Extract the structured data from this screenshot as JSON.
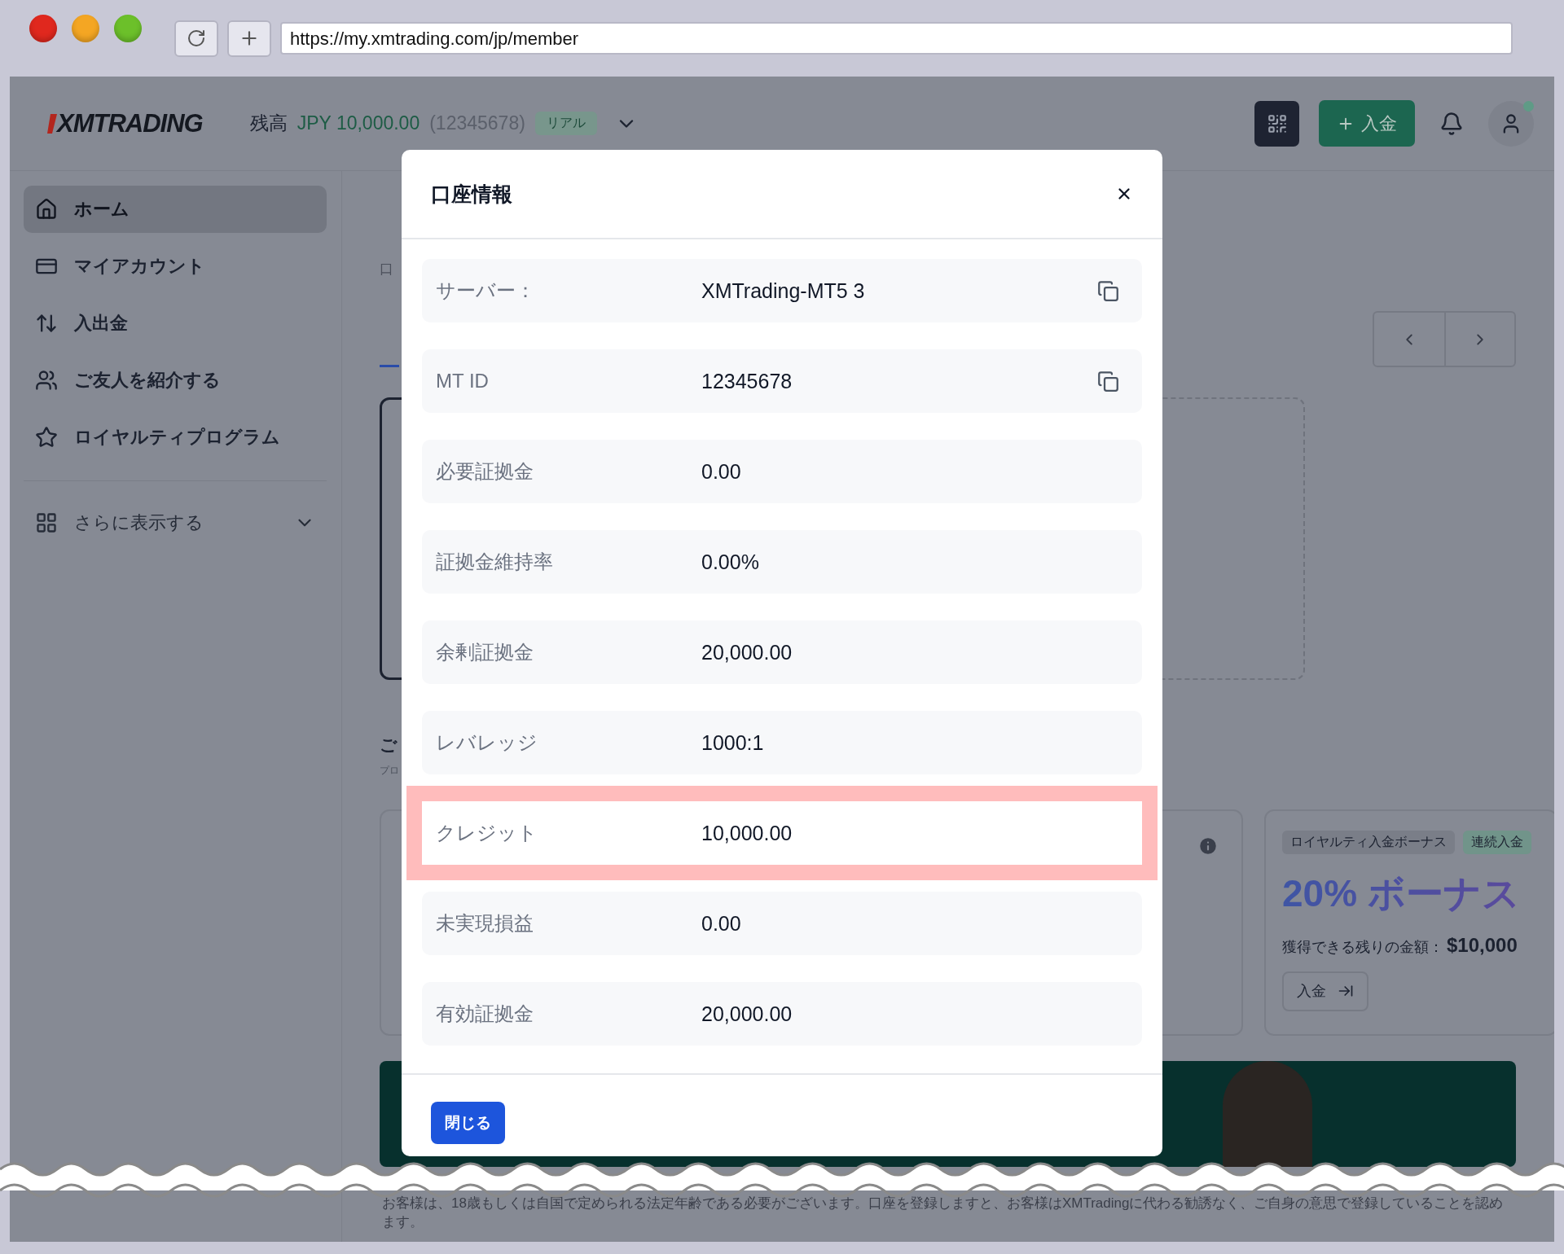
{
  "browser": {
    "url": "https://my.xmtrading.com/jp/member"
  },
  "header": {
    "logo": "XMTRADING",
    "balance_label": "残高",
    "balance": "JPY 10,000.00",
    "account_number": "(12345678)",
    "account_type": "リアル",
    "deposit_button": "入金"
  },
  "sidebar": {
    "items": [
      {
        "label": "ホーム",
        "kind": "home",
        "selected": true
      },
      {
        "label": "マイアカウント",
        "kind": "card",
        "selected": false
      },
      {
        "label": "入出金",
        "kind": "transfer",
        "selected": false
      },
      {
        "label": "ご友人を紹介する",
        "kind": "people",
        "selected": false
      },
      {
        "label": "ロイヤルティプログラム",
        "kind": "star",
        "selected": false
      }
    ],
    "more": {
      "label": "さらに表示する",
      "expanded": false
    }
  },
  "background": {
    "section_1_subtitle": "口",
    "section_2_title": "ご",
    "section_2_subtitle": "プロ"
  },
  "promo_card": {
    "tags": [
      {
        "label": "ロイヤルティ入金ボーナス",
        "color": "#7a7e88"
      },
      {
        "label": "連続入金",
        "color": "#71948a"
      }
    ],
    "title": "20% ボーナス",
    "remaining_label": "獲得できる残りの金額：",
    "remaining_amount": "$10,000",
    "button": "入金"
  },
  "modal": {
    "title": "口座情報",
    "rows": [
      {
        "label": "サーバー：",
        "value": "XMTrading-MT5 3",
        "copyable": true,
        "highlighted": false
      },
      {
        "label": "MT ID",
        "value": "12345678",
        "copyable": true,
        "highlighted": false
      },
      {
        "label": "必要証拠金",
        "value": "0.00",
        "copyable": false,
        "highlighted": false
      },
      {
        "label": "証拠金維持率",
        "value": "0.00%",
        "copyable": false,
        "highlighted": false
      },
      {
        "label": "余剰証拠金",
        "value": "20,000.00",
        "copyable": false,
        "highlighted": false
      },
      {
        "label": "レバレッジ",
        "value": "1000:1",
        "copyable": false,
        "highlighted": false
      },
      {
        "label": "クレジット",
        "value": "10,000.00",
        "copyable": false,
        "highlighted": true
      },
      {
        "label": "未実現損益",
        "value": "0.00",
        "copyable": false,
        "highlighted": false
      },
      {
        "label": "有効証拠金",
        "value": "20,000.00",
        "copyable": false,
        "highlighted": false
      }
    ],
    "close_button": "閉じる"
  },
  "disclaimer": "お客様は、18歳もしくは自国で定められる法定年齢である必要がございます。口座を登録しますと、お客様はXMTradingに代わる勧誘なく、ご自身の意思で登録していることを認めます。"
}
